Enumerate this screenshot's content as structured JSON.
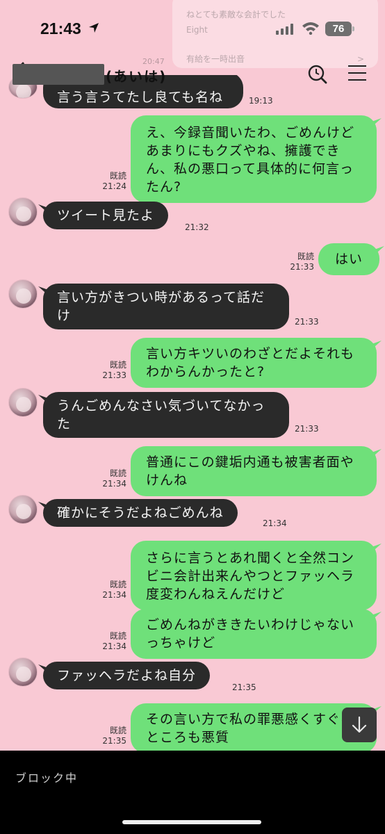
{
  "status_bar": {
    "time": "21:43",
    "battery": "76"
  },
  "notification": {
    "line1": "ねとても素敵な会計でした",
    "line2": "Eight",
    "line3_left": "有給を一時出音",
    "line3_right": ">"
  },
  "header": {
    "contact_name": "(あいは)",
    "faded_time": "20:47"
  },
  "messages": [
    {
      "id": 0,
      "side": "them",
      "text": "言う言うてたし良ても名ね",
      "time": "19:13"
    },
    {
      "id": 1,
      "side": "me",
      "text": "え、今録音聞いたわ、ごめんけどあまりにもクズやね、擁護できん、私の悪口って具体的に何言ったん?",
      "read": "既読",
      "time": "21:24"
    },
    {
      "id": 2,
      "side": "them",
      "text": "ツイート見たよ",
      "time": "21:32"
    },
    {
      "id": 3,
      "side": "me",
      "text": "はい",
      "read": "既読",
      "time": "21:33"
    },
    {
      "id": 4,
      "side": "them",
      "text": "言い方がきつい時があるって話だけ",
      "time": "21:33"
    },
    {
      "id": 5,
      "side": "me",
      "text": "言い方キツいのわざとだよそれもわからんかったと?",
      "read": "既読",
      "time": "21:33"
    },
    {
      "id": 6,
      "side": "them",
      "text": "うんごめんなさい気づいてなかった",
      "time": "21:33"
    },
    {
      "id": 7,
      "side": "me",
      "text": "普通にこの鍵垢内通も被害者面やけんね",
      "read": "既読",
      "time": "21:34"
    },
    {
      "id": 8,
      "side": "them",
      "text": "確かにそうだよねごめんね",
      "time": "21:34"
    },
    {
      "id": 9,
      "side": "me",
      "text": "さらに言うとあれ聞くと全然コンビニ会計出来んやつとファッヘラ度変わんねえんだけど",
      "read": "既読",
      "time": "21:34"
    },
    {
      "id": 10,
      "side": "me",
      "text": "ごめんねがききたいわけじゃないっちゃけど",
      "read": "既読",
      "time": "21:34"
    },
    {
      "id": 11,
      "side": "them",
      "text": "ファッヘラだよね自分",
      "time": "21:35"
    },
    {
      "id": 12,
      "side": "me",
      "text": "その言い方で私の罪悪感くすぐるところも悪質",
      "read": "既読",
      "time": "21:35"
    }
  ],
  "footer": {
    "blocked_label": "ブロック中"
  },
  "colors": {
    "background": "#f9c9d4",
    "my_bubble": "#6fe07a",
    "their_bubble": "#2a2a2a"
  },
  "icons": [
    "location-arrow-icon",
    "signal-icon",
    "wifi-icon",
    "battery-icon",
    "back-chevron-icon",
    "search-icon",
    "menu-icon",
    "arrow-down-icon"
  ]
}
